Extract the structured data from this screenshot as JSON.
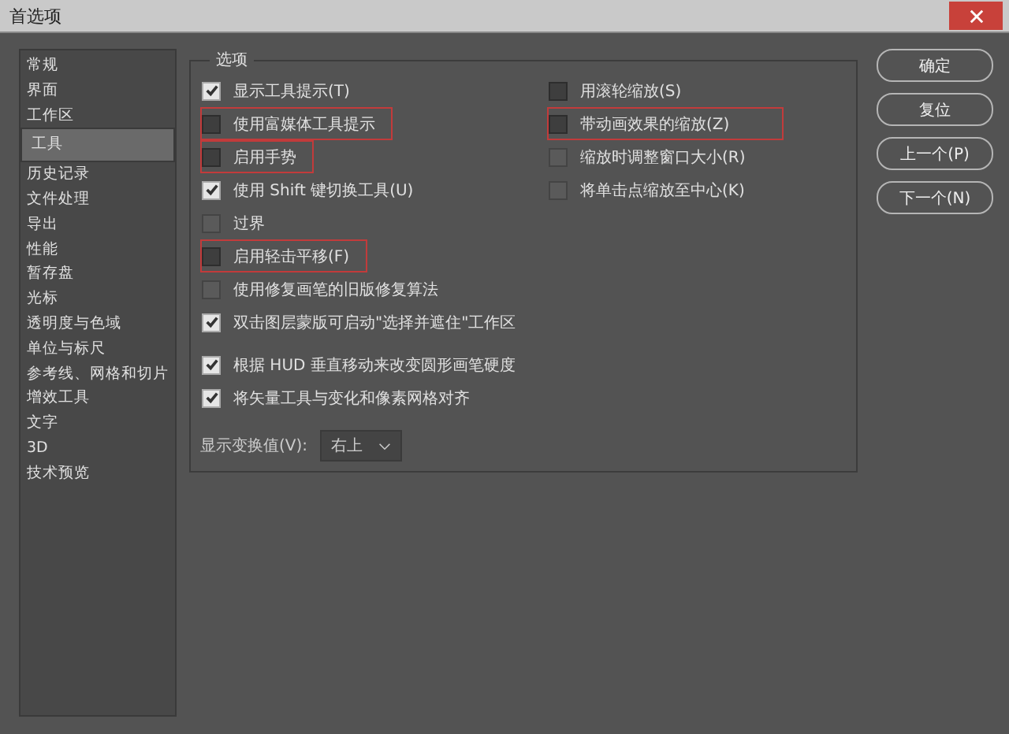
{
  "window": {
    "title": "首选项"
  },
  "sidebar": {
    "items": [
      {
        "label": "常规",
        "selected": false
      },
      {
        "label": "界面",
        "selected": false
      },
      {
        "label": "工作区",
        "selected": false
      },
      {
        "label": "工具",
        "selected": true
      },
      {
        "label": "历史记录",
        "selected": false
      },
      {
        "label": "文件处理",
        "selected": false
      },
      {
        "label": "导出",
        "selected": false
      },
      {
        "label": "性能",
        "selected": false
      },
      {
        "label": "暂存盘",
        "selected": false
      },
      {
        "label": "光标",
        "selected": false
      },
      {
        "label": "透明度与色域",
        "selected": false
      },
      {
        "label": "单位与标尺",
        "selected": false
      },
      {
        "label": "参考线、网格和切片",
        "selected": false
      },
      {
        "label": "增效工具",
        "selected": false
      },
      {
        "label": "文字",
        "selected": false
      },
      {
        "label": "3D",
        "selected": false
      },
      {
        "label": "技术预览",
        "selected": false
      }
    ]
  },
  "options": {
    "title": "选项",
    "left_groups": [
      [
        {
          "label": "显示工具提示(T)",
          "checked": true,
          "disabled": false,
          "highlighted": false
        },
        {
          "label": "使用富媒体工具提示",
          "checked": false,
          "disabled": false,
          "highlighted": true
        },
        {
          "label": "启用手势",
          "checked": false,
          "disabled": false,
          "highlighted": true
        },
        {
          "label": "使用 Shift 键切换工具(U)",
          "checked": true,
          "disabled": false,
          "highlighted": false
        },
        {
          "label": "过界",
          "checked": false,
          "disabled": true,
          "highlighted": false
        },
        {
          "label": "启用轻击平移(F)",
          "checked": false,
          "disabled": false,
          "highlighted": true
        },
        {
          "label": "使用修复画笔的旧版修复算法",
          "checked": false,
          "disabled": true,
          "highlighted": false
        },
        {
          "label": "双击图层蒙版可启动\"选择并遮住\"工作区",
          "checked": true,
          "disabled": false,
          "highlighted": false
        }
      ],
      [
        {
          "label": "根据 HUD 垂直移动来改变圆形画笔硬度",
          "checked": true,
          "disabled": false,
          "highlighted": false
        },
        {
          "label": "将矢量工具与变化和像素网格对齐",
          "checked": true,
          "disabled": false,
          "highlighted": false
        }
      ]
    ],
    "right": [
      {
        "label": "用滚轮缩放(S)",
        "checked": false,
        "disabled": false,
        "highlighted": false
      },
      {
        "label": "带动画效果的缩放(Z)",
        "checked": false,
        "disabled": false,
        "highlighted": true
      },
      {
        "label": "缩放时调整窗口大小(R)",
        "checked": false,
        "disabled": true,
        "highlighted": false
      },
      {
        "label": "将单击点缩放至中心(K)",
        "checked": false,
        "disabled": true,
        "highlighted": false
      }
    ],
    "transform_values": {
      "label": "显示变换值(V):",
      "value": "右上"
    }
  },
  "buttons": [
    "确定",
    "复位",
    "上一个(P)",
    "下一个(N)"
  ]
}
